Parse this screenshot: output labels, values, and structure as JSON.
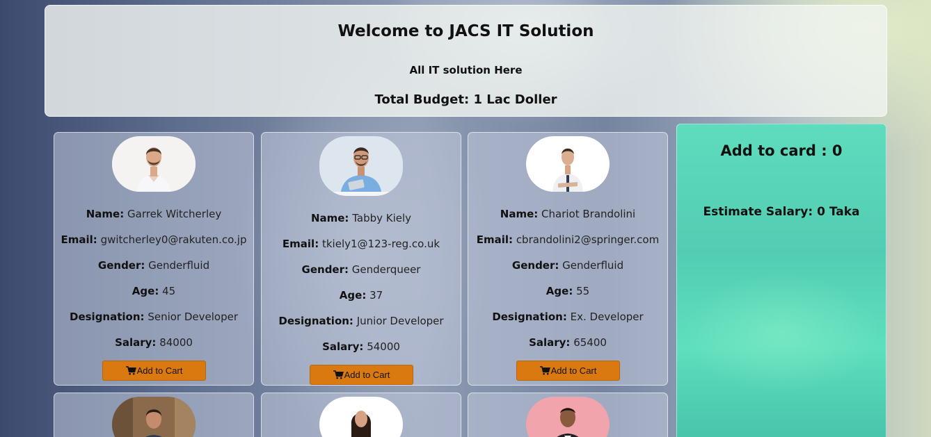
{
  "header": {
    "title": "Welcome to JACS IT Solution",
    "subtitle": "All IT solution Here",
    "budget": "Total Budget: 1 Lac Doller"
  },
  "labels": {
    "name": "Name:",
    "email": "Email:",
    "gender": "Gender:",
    "age": "Age:",
    "designation": "Designation:",
    "salary": "Salary:",
    "add_to_cart": "Add to Cart"
  },
  "employees": [
    {
      "name": "Garrek Witcherley",
      "email": "gwitcherley0@rakuten.co.jp",
      "gender": "Genderfluid",
      "age": "45",
      "designation": "Senior Developer",
      "salary": "84000"
    },
    {
      "name": "Tabby Kiely",
      "email": "tkiely1@123-reg.co.uk",
      "gender": "Genderqueer",
      "age": "37",
      "designation": "Junior Developer",
      "salary": "54000"
    },
    {
      "name": "Chariot Brandolini",
      "email": "cbrandolini2@springer.com",
      "gender": "Genderfluid",
      "age": "55",
      "designation": "Ex. Developer",
      "salary": "65400"
    }
  ],
  "cart": {
    "title": "Add to card : 0",
    "estimate": "Estimate Salary: 0 Taka"
  },
  "colors": {
    "button": "#d9790f",
    "cart_panel": "#5fdbbd"
  }
}
